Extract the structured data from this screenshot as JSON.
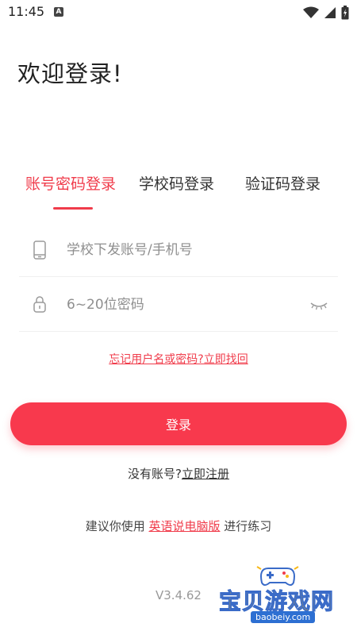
{
  "status_bar": {
    "time": "11:45",
    "notification_glyph": "A"
  },
  "welcome_title": "欢迎登录!",
  "tabs": [
    {
      "label": "账号密码登录",
      "active": true
    },
    {
      "label": "学校码登录",
      "active": false
    },
    {
      "label": "验证码登录",
      "active": false
    }
  ],
  "account_field": {
    "placeholder": "学校下发账号/手机号",
    "value": "",
    "icon": "phone-icon"
  },
  "password_field": {
    "placeholder": "6~20位密码",
    "value": "",
    "icon": "lock-icon",
    "toggle_icon": "eye-closed-icon"
  },
  "forgot_link": "忘记用户名或密码?立即找回",
  "login_button": "登录",
  "register": {
    "prompt": "没有账号?",
    "link": "立即注册"
  },
  "suggestion": {
    "prefix": "建议你使用",
    "link": "英语说电脑版",
    "suffix": "进行练习"
  },
  "version": "V3.4.62",
  "watermark": {
    "text": "宝贝游戏网",
    "url": "baobeiy.com"
  },
  "colors": {
    "accent": "#f03c4b",
    "button": "#f8394d",
    "placeholder": "#8f8f8f",
    "divider": "#efefef"
  }
}
